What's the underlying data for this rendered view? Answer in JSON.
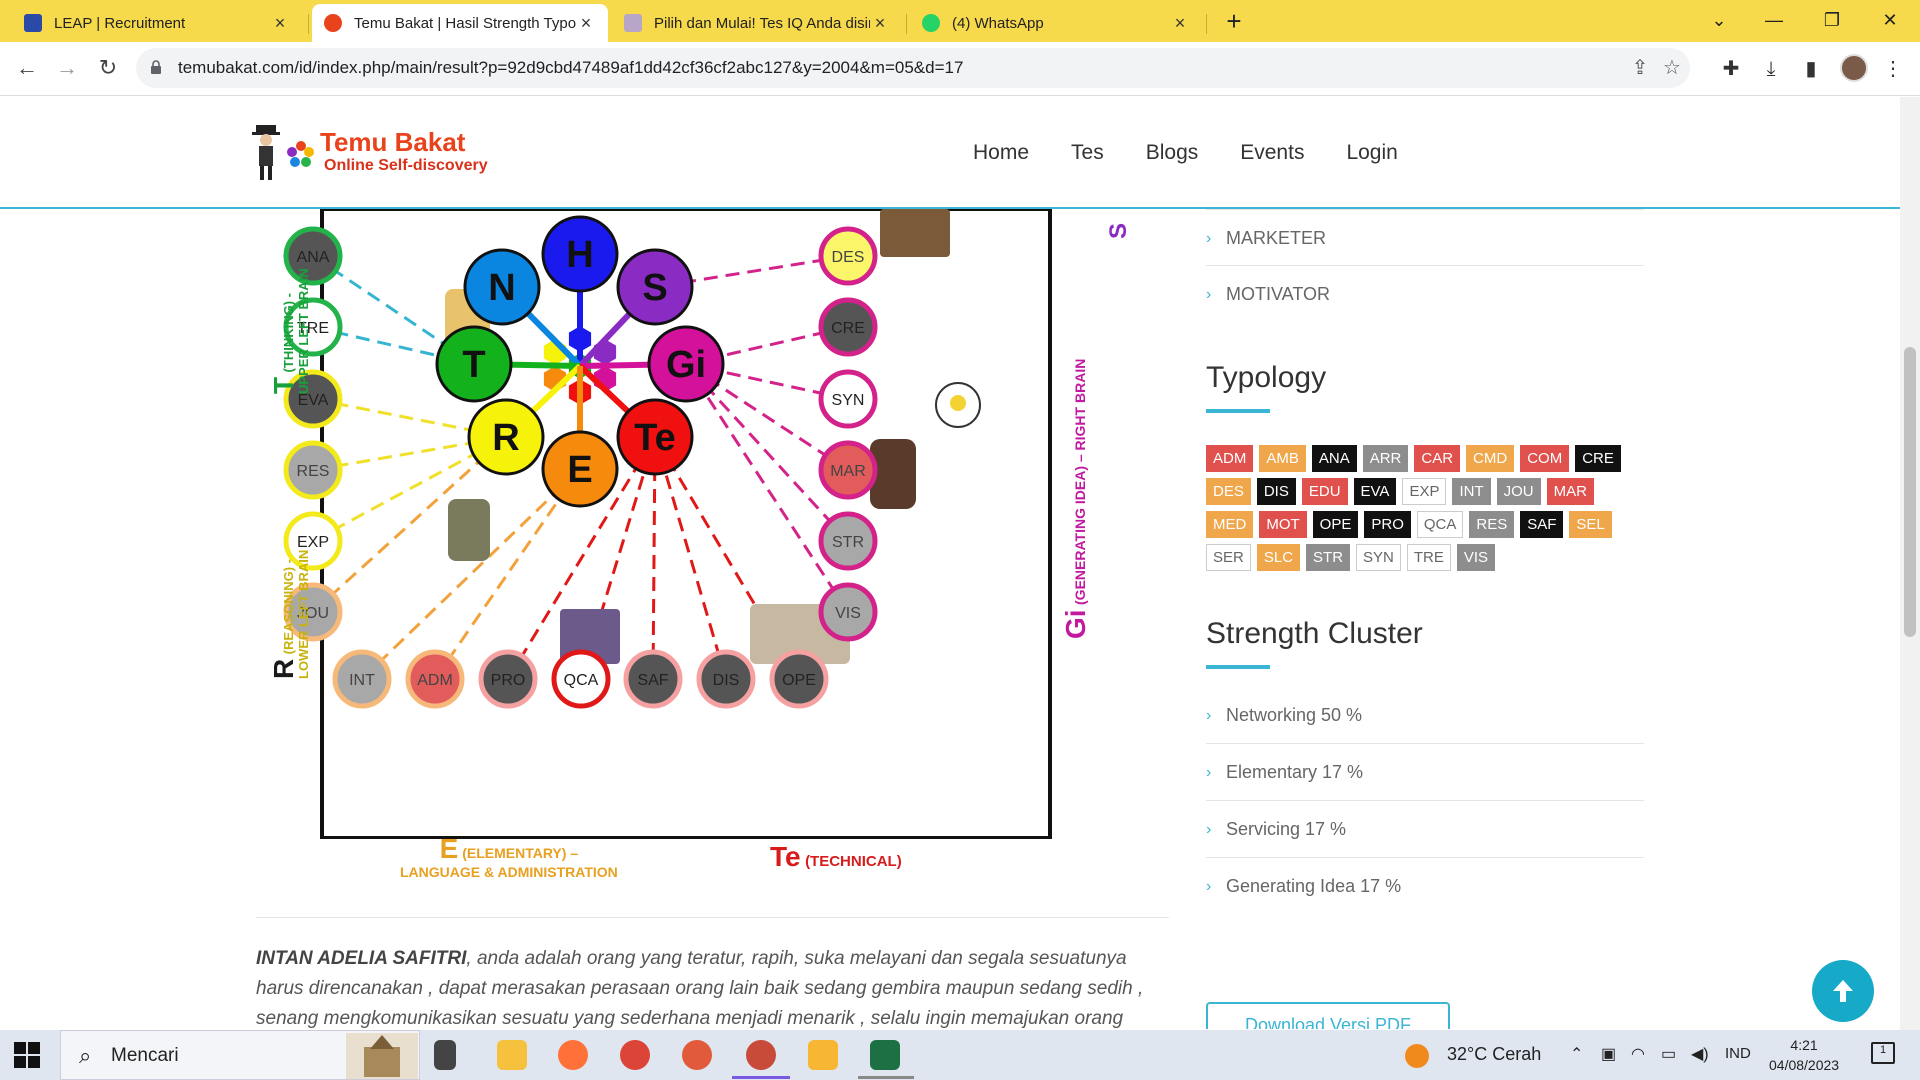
{
  "browser": {
    "tabs": [
      {
        "title": "LEAP | Recruitment",
        "favicon_color": "#2b4aa8"
      },
      {
        "title": "Temu Bakat | Hasil Strength Typology",
        "favicon_color": "#e8431c"
      },
      {
        "title": "Pilih dan Mulai! Tes IQ Anda disini",
        "favicon_color": "#b7a6c8"
      },
      {
        "title": "(4) WhatsApp",
        "favicon_color": "#25d366"
      }
    ],
    "close_glyph": "×",
    "new_tab_glyph": "+",
    "url": "temubakat.com/id/index.php/main/result?p=92d9cbd47489af1dd42cf36cf2abc127&y=2004&m=05&d=17"
  },
  "header": {
    "logo_title": "Temu Bakat",
    "logo_subtitle": "Online Self-discovery",
    "nav": [
      "Home",
      "Tes",
      "Blogs",
      "Events",
      "Login"
    ]
  },
  "diagram": {
    "hubs": [
      {
        "label": "H",
        "color": "#1a1aee"
      },
      {
        "label": "S",
        "color": "#8a2bc4"
      },
      {
        "label": "N",
        "color": "#0a86e0"
      },
      {
        "label": "Gi",
        "color": "#d4119a"
      },
      {
        "label": "T",
        "color": "#13b21c"
      },
      {
        "label": "Te",
        "color": "#f01010"
      },
      {
        "label": "R",
        "color": "#f7f20a"
      },
      {
        "label": "E",
        "color": "#f68a0c"
      }
    ],
    "left_column": [
      {
        "label": "ANA",
        "fill": "#555555",
        "ring": "#23b34a",
        "text": "#222"
      },
      {
        "label": "TRE",
        "fill": "#ffffff",
        "ring": "#23b34a",
        "text": "#222"
      },
      {
        "label": "EVA",
        "fill": "#555555",
        "ring": "#f3ea1c",
        "text": "#222"
      },
      {
        "label": "RES",
        "fill": "#a8a8a8",
        "ring": "#f3ea1c",
        "text": "#444"
      },
      {
        "label": "EXP",
        "fill": "#ffffff",
        "ring": "#f3ea1c",
        "text": "#222"
      },
      {
        "label": "JOU",
        "fill": "#a8a8a8",
        "ring": "#f7b97a",
        "text": "#444"
      }
    ],
    "right_column": [
      {
        "label": "DES",
        "fill": "#fbf56a",
        "ring": "#d3238a",
        "text": "#444"
      },
      {
        "label": "CRE",
        "fill": "#555555",
        "ring": "#d3238a",
        "text": "#222"
      },
      {
        "label": "SYN",
        "fill": "#ffffff",
        "ring": "#d3238a",
        "text": "#222"
      },
      {
        "label": "MAR",
        "fill": "#e25c5c",
        "ring": "#d3238a",
        "text": "#444"
      },
      {
        "label": "STR",
        "fill": "#a8a8a8",
        "ring": "#d3238a",
        "text": "#444"
      },
      {
        "label": "VIS",
        "fill": "#a8a8a8",
        "ring": "#d3238a",
        "text": "#444"
      }
    ],
    "bottom_row": [
      {
        "label": "INT",
        "fill": "#a8a8a8",
        "ring": "#f7b97a",
        "text": "#444"
      },
      {
        "label": "ADM",
        "fill": "#e25c5c",
        "ring": "#f7b97a",
        "text": "#444"
      },
      {
        "label": "PRO",
        "fill": "#555555",
        "ring": "#f6a1a1",
        "text": "#222"
      },
      {
        "label": "QCA",
        "fill": "#ffffff",
        "ring": "#e01818",
        "text": "#222"
      },
      {
        "label": "SAF",
        "fill": "#555555",
        "ring": "#f6a1a1",
        "text": "#222"
      },
      {
        "label": "DIS",
        "fill": "#555555",
        "ring": "#f6a1a1",
        "text": "#222"
      },
      {
        "label": "OPE",
        "fill": "#555555",
        "ring": "#f6a1a1",
        "text": "#222"
      }
    ],
    "left_label_top": {
      "letter": "T",
      "text": "(THINKING) -",
      "text2": "UPPER LEFT BRAIN"
    },
    "left_label_bottom": {
      "letter": "R",
      "text": "(REASONING) -",
      "text2": "LOWER LEFT BRAIN"
    },
    "right_label": {
      "letter": "Gi",
      "text": "(GENERATING IDEA) – RIGHT BRAIN"
    },
    "right_label_top_letter": "S",
    "caption_e_letter": "E",
    "caption_e_line1": "(ELEMENTARY) –",
    "caption_e_line2": "LANGUAGE & ADMINISTRATION",
    "caption_te_letter": "Te",
    "caption_te_text": "(TECHNICAL)"
  },
  "description": {
    "name": "INTAN ADELIA SAFITRI",
    "text": ", anda adalah orang yang teratur, rapih, suka melayani dan segala sesuatunya harus direncanakan , dapat merasakan perasaan orang lain baik sedang gembira maupun sedang sedih , senang mengkomunikasikan sesuatu yang sederhana menjadi menarik , selalu ingin memajukan orang"
  },
  "sidebar": {
    "role_links": [
      "MARKETER",
      "MOTIVATOR"
    ],
    "typology_heading": "Typology",
    "tags": [
      {
        "label": "ADM",
        "style": "red"
      },
      {
        "label": "AMB",
        "style": "orange"
      },
      {
        "label": "ANA",
        "style": "black"
      },
      {
        "label": "ARR",
        "style": "gray"
      },
      {
        "label": "CAR",
        "style": "red"
      },
      {
        "label": "CMD",
        "style": "orange"
      },
      {
        "label": "COM",
        "style": "red"
      },
      {
        "label": "CRE",
        "style": "black"
      },
      {
        "label": "DES",
        "style": "orange"
      },
      {
        "label": "DIS",
        "style": "black"
      },
      {
        "label": "EDU",
        "style": "red"
      },
      {
        "label": "EVA",
        "style": "black"
      },
      {
        "label": "EXP",
        "style": "outline"
      },
      {
        "label": "INT",
        "style": "gray"
      },
      {
        "label": "JOU",
        "style": "gray"
      },
      {
        "label": "MAR",
        "style": "red"
      },
      {
        "label": "MED",
        "style": "orange"
      },
      {
        "label": "MOT",
        "style": "red"
      },
      {
        "label": "OPE",
        "style": "black"
      },
      {
        "label": "PRO",
        "style": "black"
      },
      {
        "label": "QCA",
        "style": "outline"
      },
      {
        "label": "RES",
        "style": "gray"
      },
      {
        "label": "SAF",
        "style": "black"
      },
      {
        "label": "SEL",
        "style": "orange"
      },
      {
        "label": "SER",
        "style": "outline"
      },
      {
        "label": "SLC",
        "style": "orange"
      },
      {
        "label": "STR",
        "style": "gray"
      },
      {
        "label": "SYN",
        "style": "outline"
      },
      {
        "label": "TRE",
        "style": "outline"
      },
      {
        "label": "VIS",
        "style": "gray"
      }
    ],
    "cluster_heading": "Strength Cluster",
    "clusters": [
      "Networking 50 %",
      "Elementary 17 %",
      "Servicing 17 %",
      "Generating Idea 17 %"
    ],
    "download_label": "Download Versi PDF"
  },
  "taskbar": {
    "search_placeholder": "Mencari",
    "weather": "32°C  Cerah",
    "language": "IND",
    "time": "4:21",
    "date": "04/08/2023",
    "notification_count": "1"
  }
}
